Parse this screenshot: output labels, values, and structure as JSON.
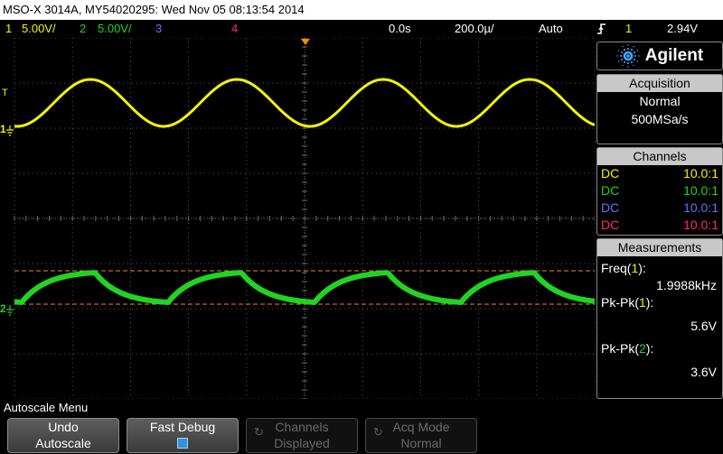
{
  "title_bar": {
    "text": "MSO-X 3014A, MY54020295: Wed Nov 05 08:13:54 2014"
  },
  "status_bar": {
    "ch1_num": "1",
    "ch1_scale": "5.00V/",
    "ch2_num": "2",
    "ch2_scale": "5.00V/",
    "ch3_num": "3",
    "ch4_num": "4",
    "time_offset": "0.0s",
    "time_scale": "200.0µ/",
    "trigger_mode": "Auto",
    "trigger_icon": "rising-edge-trigger-icon",
    "trigger_source": "1",
    "trigger_level": "2.94V"
  },
  "colors": {
    "ch1": "#f5f500",
    "ch2": "#22d422",
    "ch3": "#6c6cff",
    "ch4": "#ff2a6a",
    "cursor": "#e68a22",
    "trigger_marker": "#ff8a00"
  },
  "scope": {
    "ch1_ground_marker": "1",
    "ch2_ground_marker": "2",
    "trigger_level_marker": "T"
  },
  "panel": {
    "brand": "Agilent",
    "acquisition": {
      "heading": "Acquisition",
      "mode": "Normal",
      "rate": "500MSa/s"
    },
    "channels": {
      "heading": "Channels",
      "rows": [
        {
          "coupling": "DC",
          "probe": "10.0:1"
        },
        {
          "coupling": "DC",
          "probe": "10.0:1"
        },
        {
          "coupling": "DC",
          "probe": "10.0:1"
        },
        {
          "coupling": "DC",
          "probe": "10.0:1"
        }
      ]
    },
    "measurements": {
      "heading": "Measurements",
      "items": [
        {
          "label_prefix": "Freq(",
          "channel": "1",
          "label_suffix": "):",
          "value": "1.9988kHz"
        },
        {
          "label_prefix": "Pk-Pk(",
          "channel": "1",
          "label_suffix": "):",
          "value": "5.6V"
        },
        {
          "label_prefix": "Pk-Pk(",
          "channel": "2",
          "label_suffix": "):",
          "value": "3.6V"
        }
      ]
    }
  },
  "menu": {
    "title": "Autoscale Menu",
    "softkeys": [
      {
        "line1": "Undo",
        "line2": "Autoscale"
      },
      {
        "line1": "Fast Debug",
        "checked": true
      },
      {
        "line1": "Channels",
        "line2": "Displayed",
        "icon": "rotate-knob-icon"
      },
      {
        "line1": "Acq Mode",
        "line2": "Normal",
        "icon": "rotate-knob-icon"
      }
    ]
  }
}
